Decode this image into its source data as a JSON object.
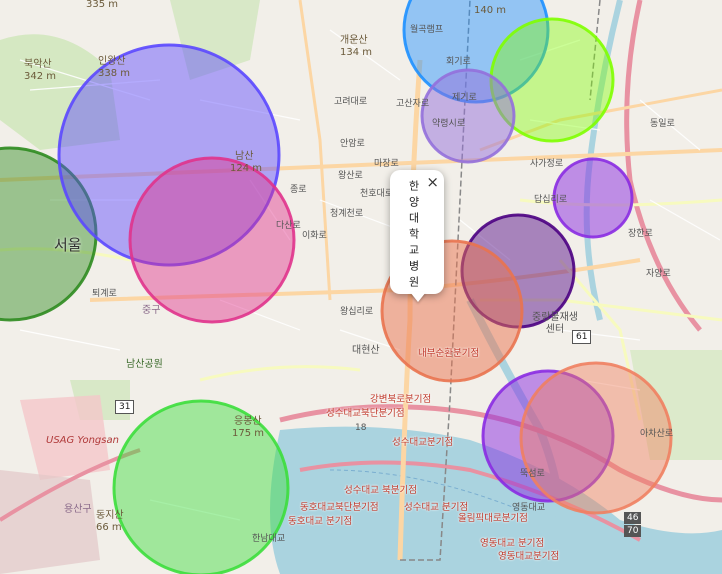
{
  "map": {
    "popup": {
      "text": "한양대학교병원",
      "close": "×"
    },
    "big_label": "서울",
    "peaks": [
      {
        "name": "북악산",
        "elev": "342 m"
      },
      {
        "name": "인왕산",
        "elev": "338 m"
      },
      {
        "name": "개운산",
        "elev": "134 m"
      },
      {
        "name": "남산",
        "elev": "124 m"
      },
      {
        "name": "응봉산",
        "elev": "175 m"
      },
      {
        "name": "동지산",
        "elev": "66 m"
      }
    ],
    "top_elev": "335 m",
    "cut_elev": "140 m",
    "areas": {
      "usag": "USAG Yongsan",
      "yongsan": "용산구",
      "jung": "중구",
      "namsan_park": "남산공원",
      "daehyeonsan": "대현산",
      "jungnang_center": "중랑물재생센터",
      "wolgok": "월곡램프"
    },
    "branches": [
      "내부순환분기점",
      "강변북로분기점",
      "성수대교북단분기점",
      "성수대교분기점",
      "성수대교 북분기점",
      "동호대교북단분기점",
      "동호대교 분기점",
      "성수대교 분기점",
      "올림픽대로분기점",
      "영동대교 분기점",
      "영동대교분기점",
      "강변북로분기점"
    ],
    "roads": [
      "마장로",
      "왕산로",
      "천호대로",
      "청계천로",
      "고산자로",
      "동일로",
      "사가정로",
      "답십리로",
      "왕십리로",
      "장한로",
      "자양로",
      "아차산로",
      "뚝섬로",
      "영동대교",
      "한남대교",
      "이화로",
      "종로",
      "퇴계로",
      "다산로",
      "고려대로",
      "안암로",
      "제기로",
      "약령시로",
      "회기로"
    ],
    "shields": [
      "61",
      "31",
      "18",
      "46",
      "70"
    ],
    "circles": [
      {
        "color": "#2e8b1f"
      },
      {
        "color": "#5b48ff"
      },
      {
        "color": "#e0338c"
      },
      {
        "color": "#1e90ff"
      },
      {
        "color": "#7fff00"
      },
      {
        "color": "#9370db"
      },
      {
        "color": "#8a2be2"
      },
      {
        "color": "#4b0082"
      },
      {
        "color": "#e9734f"
      },
      {
        "color": "#8a2be2"
      },
      {
        "color": "#f08060"
      },
      {
        "color": "#3cde3c"
      }
    ]
  }
}
